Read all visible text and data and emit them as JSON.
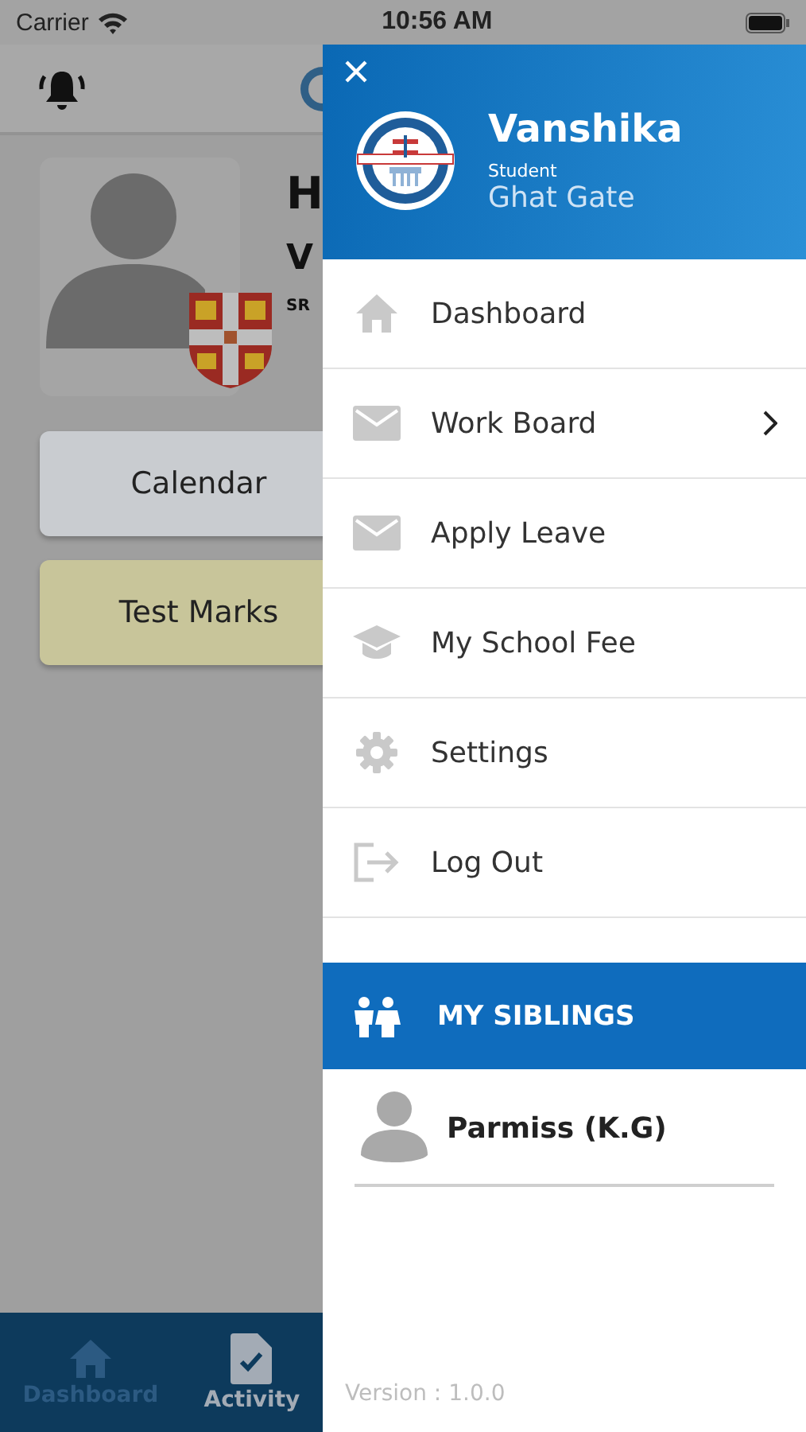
{
  "status_bar": {
    "carrier": "Carrier",
    "time": "10:56 AM"
  },
  "background": {
    "header_cut": "H",
    "name_cut": "V",
    "school_cut": "SR",
    "buttons": [
      {
        "label": "Calendar",
        "color": "#c9ccd0"
      },
      {
        "label": "Test Marks",
        "color": "#c8c59a"
      }
    ],
    "tabs": [
      {
        "label": "Dashboard",
        "selected": false
      },
      {
        "label": "Activity",
        "selected": true
      }
    ]
  },
  "drawer": {
    "name": "Vanshika",
    "role": "Student",
    "branch": "Ghat Gate",
    "menu": [
      {
        "label": "Dashboard",
        "has_submenu": false
      },
      {
        "label": "Work Board",
        "has_submenu": true
      },
      {
        "label": "Apply Leave",
        "has_submenu": false
      },
      {
        "label": "My School Fee",
        "has_submenu": false
      },
      {
        "label": "Settings",
        "has_submenu": false
      },
      {
        "label": "Log Out",
        "has_submenu": false
      }
    ],
    "siblings_title": "MY SIBLINGS",
    "siblings": [
      {
        "name": "Parmiss  (K.G)"
      }
    ],
    "version": "Version : 1.0.0"
  }
}
